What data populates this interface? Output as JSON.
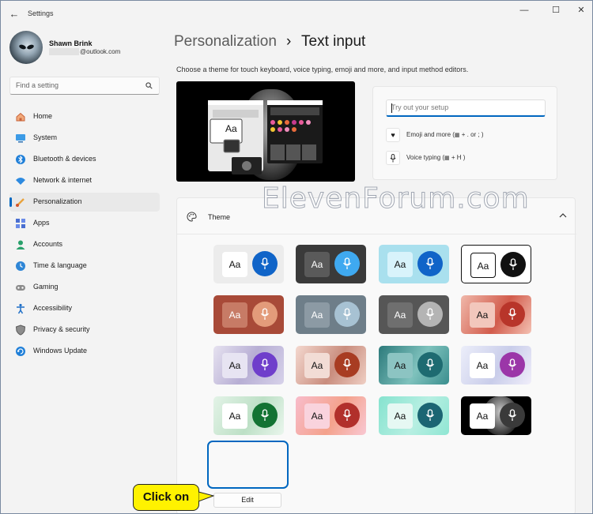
{
  "window": {
    "app_title": "Settings",
    "controls": {
      "minimize": "—",
      "maximize": "☐",
      "close": "✕"
    }
  },
  "profile": {
    "name": "Shawn Brink",
    "email_suffix": "@outlook.com"
  },
  "search": {
    "placeholder": "Find a setting"
  },
  "nav": {
    "items": [
      {
        "label": "Home",
        "icon": "home-icon"
      },
      {
        "label": "System",
        "icon": "system-icon"
      },
      {
        "label": "Bluetooth & devices",
        "icon": "bluetooth-icon"
      },
      {
        "label": "Network & internet",
        "icon": "wifi-icon"
      },
      {
        "label": "Personalization",
        "icon": "brush-icon",
        "active": true
      },
      {
        "label": "Apps",
        "icon": "apps-icon"
      },
      {
        "label": "Accounts",
        "icon": "person-icon"
      },
      {
        "label": "Time & language",
        "icon": "globe-clock-icon"
      },
      {
        "label": "Gaming",
        "icon": "controller-icon"
      },
      {
        "label": "Accessibility",
        "icon": "accessibility-icon"
      },
      {
        "label": "Privacy & security",
        "icon": "shield-icon"
      },
      {
        "label": "Windows Update",
        "icon": "update-icon"
      }
    ]
  },
  "header": {
    "parent": "Personalization",
    "separator": "›",
    "title": "Text input",
    "description": "Choose a theme for touch keyboard, voice typing, emoji and more, and input method editors."
  },
  "preview": {
    "aa_label": "Aa"
  },
  "tryout": {
    "placeholder": "Try out your setup",
    "emoji_label": "Emoji and more (",
    "emoji_shortcut": " + . or ; )",
    "voice_label": "Voice typing (",
    "voice_shortcut": " + H )"
  },
  "theme": {
    "label": "Theme",
    "aa": "Aa",
    "edit_label": "Edit",
    "selected_index": 16,
    "tiles": [
      {
        "bg": "#ececec",
        "aa_bg": "#ffffff",
        "aa_fg": "#111111",
        "mic_bg": "#1064c8"
      },
      {
        "bg": "#3a3a3a",
        "aa_bg": "#5a5a5a",
        "aa_fg": "#ffffff",
        "mic_bg": "#3fa9f0"
      },
      {
        "bg": "#a9e0ee",
        "aa_bg": "#d8f3fb",
        "aa_fg": "#111111",
        "mic_bg": "#1064c8"
      },
      {
        "bg": "#ffffff",
        "aa_bg": "#ffffff",
        "aa_fg": "#111111",
        "mic_bg": "#111111",
        "border": "#111111"
      },
      {
        "bg": "#a84a38",
        "aa_bg": "#c77b66",
        "aa_fg": "#ffffff",
        "mic_bg": "#e39b7a"
      },
      {
        "bg": "#6e7e89",
        "aa_bg": "#8c9aa4",
        "aa_fg": "#ffffff",
        "mic_bg": "#a7c2d3"
      },
      {
        "bg": "#565656",
        "aa_bg": "#6f6f6f",
        "aa_fg": "#ffffff",
        "mic_bg": "#b4b4b4"
      },
      {
        "bg": "#e08d7c",
        "aa_bg": "#f2c7bc",
        "aa_fg": "#111111",
        "mic_bg": "#b8352a",
        "gradient": "linear-gradient(120deg,#f0b8aa,#d25c4c 55%,#f4c1b3)"
      },
      {
        "bg": "#c6c0dc",
        "aa_bg": "#e7e4f2",
        "aa_fg": "#111111",
        "mic_bg": "#6f3ecb",
        "gradient": "linear-gradient(120deg,#e6e2f0,#b7aed4 50%,#d7d2ea)"
      },
      {
        "bg": "#e3b8ac",
        "aa_bg": "#f2dcd5",
        "aa_fg": "#111111",
        "mic_bg": "#a83c22",
        "gradient": "linear-gradient(120deg,#f4d8cf,#c98d7e 55%,#efcfc4)"
      },
      {
        "bg": "#3b8f8c",
        "aa_bg": "#8cc4c2",
        "aa_fg": "#111111",
        "mic_bg": "#1e6b71",
        "gradient": "linear-gradient(120deg,#2c7a7b,#7fc2bd 55%,#3a8e8e)"
      },
      {
        "bg": "#dfe2f3",
        "aa_bg": "#ffffff",
        "aa_fg": "#111111",
        "mic_bg": "#9b36a8",
        "gradient": "linear-gradient(120deg,#eceefa,#c9cdea 55%,#f0eefa)"
      },
      {
        "bg": "#cfe9d6",
        "aa_bg": "#ffffff",
        "aa_fg": "#111111",
        "mic_bg": "#137333",
        "gradient": "linear-gradient(120deg,#e3f3e7,#bde0c6 55%,#eaf6ed)"
      },
      {
        "bg": "#f3a2b7",
        "aa_bg": "#f9d3dd",
        "aa_fg": "#111111",
        "mic_bg": "#b1302b",
        "gradient": "linear-gradient(120deg,#f8bccb,#f4a28c 55%,#f9c8d3)"
      },
      {
        "bg": "#7ddfc8",
        "aa_bg": "#e6f8f3",
        "aa_fg": "#111111",
        "mic_bg": "#1b6573",
        "gradient": "linear-gradient(120deg,#86e3cf,#b7efe2 55%,#8fe6d3)"
      },
      {
        "bg": "#000000",
        "aa_bg": "#ffffff",
        "aa_fg": "#111111",
        "mic_bg": "#3a3a3a",
        "custom": true
      }
    ]
  },
  "callout": {
    "text": "Click on"
  },
  "watermark": {
    "text": "ElevenForum.com"
  },
  "colors": {
    "accent": "#0067c0",
    "callout": "#fff200"
  }
}
